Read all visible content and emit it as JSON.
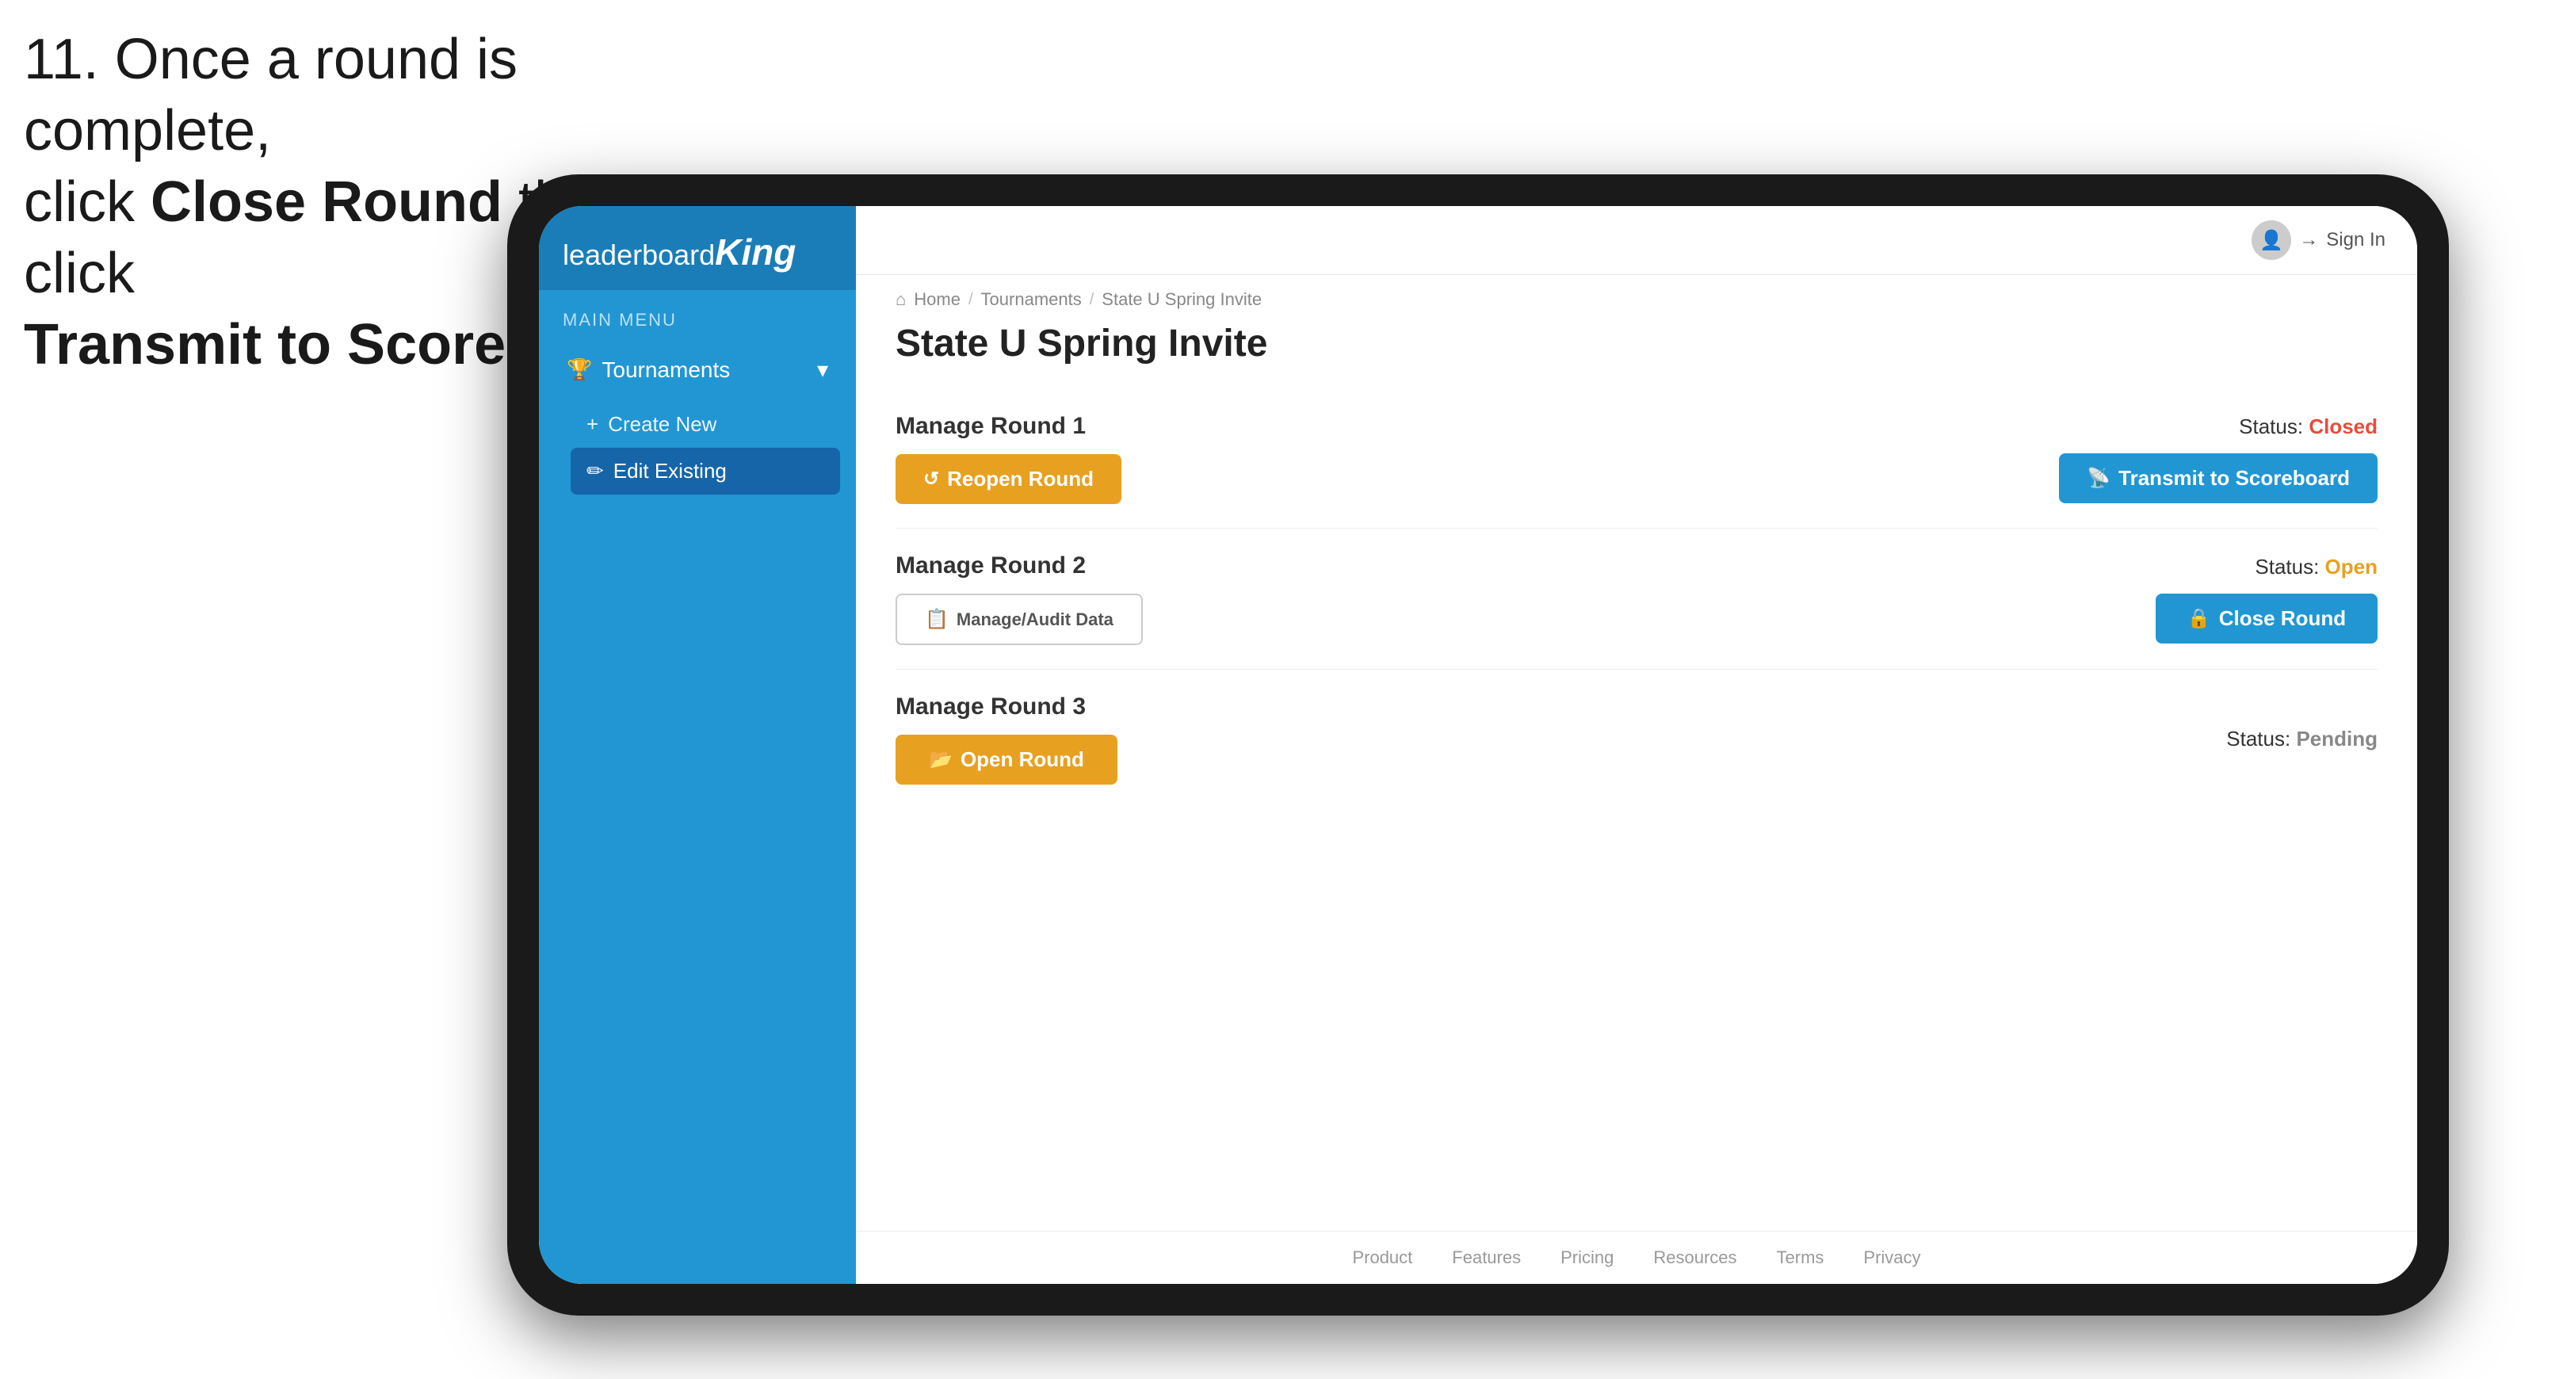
{
  "instruction": {
    "line1": "11. Once a round is complete,",
    "line2_prefix": "click ",
    "line2_bold": "Close Round",
    "line2_suffix": " then click",
    "line3_bold": "Transmit to Scoreboard."
  },
  "header": {
    "sign_in": "Sign In"
  },
  "breadcrumb": {
    "home": "Home",
    "tournaments": "Tournaments",
    "current": "State U Spring Invite"
  },
  "page": {
    "title": "State U Spring Invite"
  },
  "sidebar": {
    "main_menu_label": "MAIN MENU",
    "tournaments_label": "Tournaments",
    "create_new_label": "Create New",
    "edit_existing_label": "Edit Existing"
  },
  "rounds": [
    {
      "title": "Manage Round 1",
      "status_label": "Status:",
      "status_value": "Closed",
      "status_type": "closed",
      "primary_button": "Reopen Round",
      "primary_button_type": "gold",
      "secondary_button": "Transmit to Scoreboard",
      "secondary_button_type": "blue"
    },
    {
      "title": "Manage Round 2",
      "status_label": "Status:",
      "status_value": "Open",
      "status_type": "open",
      "primary_button": "Manage/Audit Data",
      "primary_button_type": "outline",
      "secondary_button": "Close Round",
      "secondary_button_type": "blue"
    },
    {
      "title": "Manage Round 3",
      "status_label": "Status:",
      "status_value": "Pending",
      "status_type": "pending",
      "primary_button": "Open Round",
      "primary_button_type": "gold",
      "secondary_button": null
    }
  ],
  "footer": {
    "links": [
      "Product",
      "Features",
      "Pricing",
      "Resources",
      "Terms",
      "Privacy"
    ]
  },
  "icons": {
    "trophy": "🏆",
    "plus": "+",
    "edit": "✏",
    "chevron_down": "▾",
    "arrow_right": "→",
    "transmit": "📡",
    "reopen": "↺",
    "close": "🔒",
    "open": "📂",
    "audit": "📋",
    "user": "👤",
    "signin_arrow": "→",
    "home": "⌂"
  }
}
